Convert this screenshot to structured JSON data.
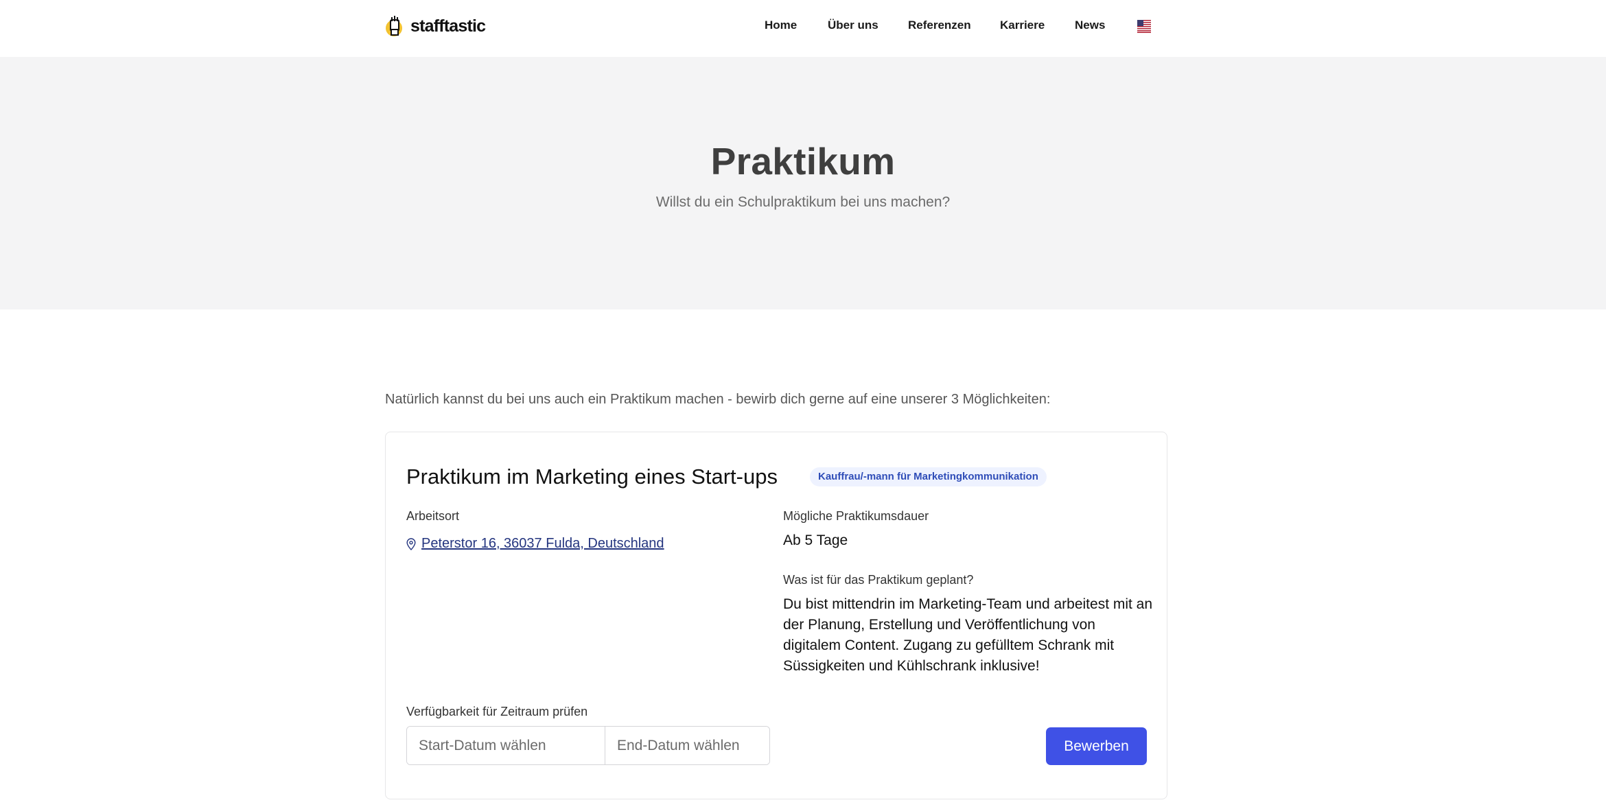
{
  "brand": {
    "name": "stafftastic"
  },
  "nav": {
    "items": [
      {
        "label": "Home"
      },
      {
        "label": "Über uns"
      },
      {
        "label": "Referenzen"
      },
      {
        "label": "Karriere"
      },
      {
        "label": "News"
      }
    ],
    "language_icon": "us-flag-icon"
  },
  "hero": {
    "title": "Praktikum",
    "subtitle": "Willst du ein Schulpraktikum bei uns machen?"
  },
  "intro": "Natürlich kannst du bei uns auch ein Praktikum machen - bewirb dich gerne auf eine unserer 3 Möglichkeiten:",
  "internship": {
    "title": "Praktikum im Marketing eines Start-ups",
    "badge": "Kauffrau/-mann für Marketingkommunikation",
    "location_label": "Arbeitsort",
    "location": "Peterstor 16, 36037 Fulda, Deutschland",
    "duration_label": "Mögliche Praktikumsdauer",
    "duration": "Ab 5 Tage",
    "plan_label": "Was ist für das Praktikum geplant?",
    "plan": "Du bist mittendrin im Marketing-Team und arbeitest mit an der Planung, Erstellung und Veröffentlichung von digitalem Content. Zugang zu gefülltem Schrank mit Süssigkeiten und Kühlschrank inklusive!",
    "availability_label": "Verfügbarkeit für Zeitraum prüfen",
    "start_placeholder": "Start-Datum wählen",
    "end_placeholder": "End-Datum wählen",
    "apply_label": "Bewerben"
  },
  "colors": {
    "accent": "#3f51e6",
    "badge_bg": "#eef2ff",
    "badge_text": "#2f4db8",
    "link": "#24357f",
    "hero_bg": "#f4f4f5"
  }
}
